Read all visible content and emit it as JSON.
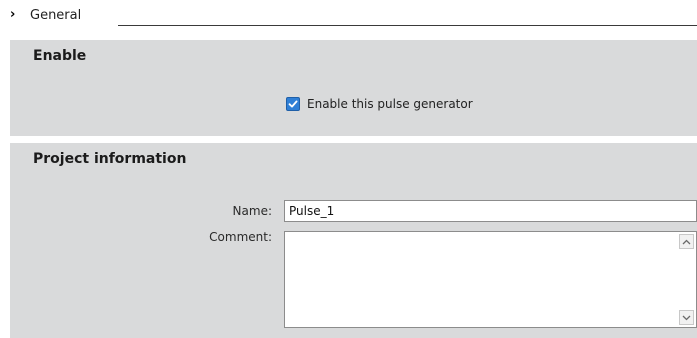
{
  "header": {
    "chevron_icon": "chevron-right-icon",
    "title": "General"
  },
  "enable_section": {
    "title": "Enable",
    "checkbox": {
      "label": "Enable this pulse generator",
      "checked": true,
      "accent_color": "#2f7fd6"
    }
  },
  "project_section": {
    "title": "Project information",
    "name": {
      "label": "Name:",
      "value": "Pulse_1"
    },
    "comment": {
      "label": "Comment:",
      "value": "",
      "scroll_up_icon": "chevron-up-icon",
      "scroll_down_icon": "chevron-down-icon"
    }
  },
  "colors": {
    "section_background": "#d9dadb",
    "page_background": "#ffffff"
  }
}
